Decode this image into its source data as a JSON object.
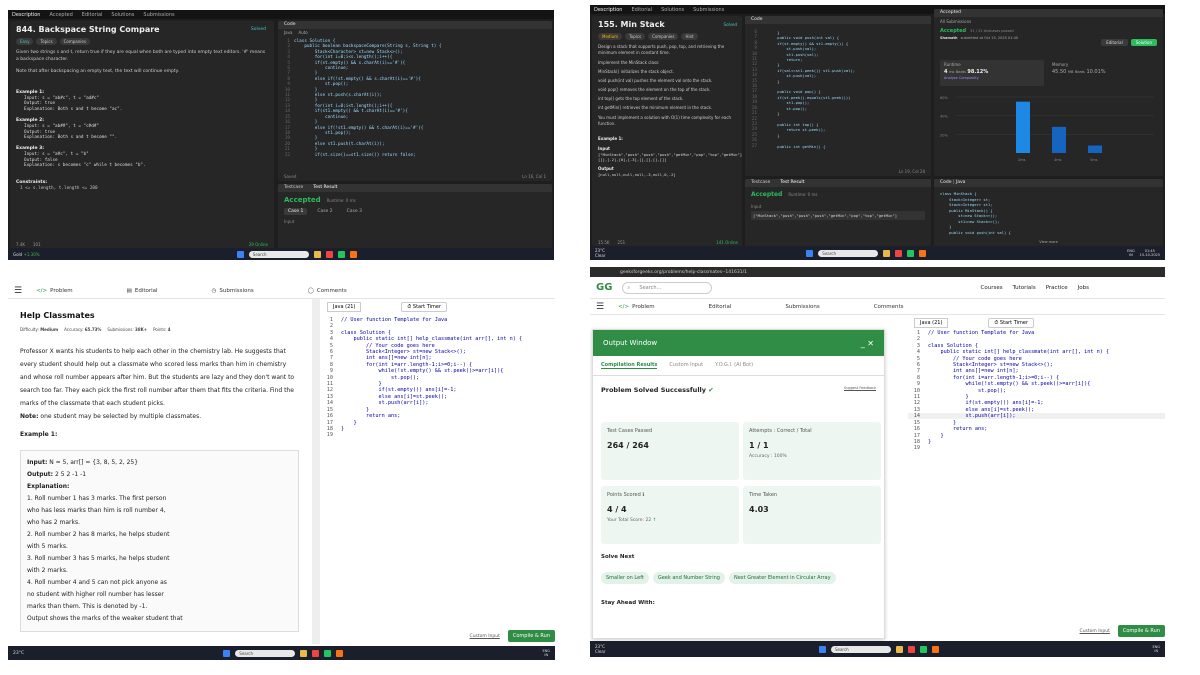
{
  "q1": {
    "nav": [
      "Description",
      "Accepted",
      "Editorial",
      "Solutions",
      "Submissions"
    ],
    "title": "844. Backspace String Compare",
    "status": "Solved",
    "tags": [
      "Easy",
      "Topics",
      "Companies"
    ],
    "desc1": "Given two strings s and t, return true if they are equal when both are typed into empty text editors. '#' means a backspace character.",
    "desc2": "Note that after backspacing an empty text, the text will continue empty.",
    "ex1_title": "Example 1:",
    "ex1": [
      "Input: s = \"ab#c\", t = \"ad#c\"",
      "Output: true",
      "Explanation: Both s and t become \"ac\"."
    ],
    "ex2_title": "Example 2:",
    "ex2": [
      "Input: s = \"ab##\", t = \"c#d#\"",
      "Output: true",
      "Explanation: Both s and t become \"\"."
    ],
    "ex3_title": "Example 3:",
    "ex3": [
      "Input: s = \"a#c\", t = \"b\"",
      "Output: false",
      "Explanation: s becomes \"c\" while t becomes \"b\"."
    ],
    "constraints": "Constraints:",
    "constraint1": "1 <= s.length, t.length <= 200",
    "likes": "7.4K",
    "comments": "101",
    "online": "29 Online",
    "code_header": "Code",
    "lang": "Java",
    "auto": "Auto",
    "code": "class Solution {\n    public boolean backspaceCompare(String s, String t) {\n        Stack<Character> st=new Stack<>();\n        for(int i=0;i<s.length();i++){\n        if(st.empty() && s.charAt(i)=='#'){\n            continue;\n        }\n        else if(!st.empty() && s.charAt(i)=='#'){\n            st.pop();\n        }\n        else st.push(s.charAt(i));\n        }\n        for(int i=0;i<t.length();i++){\n        if(st1.empty() && t.charAt(i)=='#'){\n            continue;\n        }\n        else if(!st1.empty() && t.charAt(i)=='#'){\n            st1.pop();\n        }\n        else st1.push(t.charAt(i));\n        }\n        if(st.size()==st1.size()) return false;",
    "saved": "Saved",
    "pos": "Ln 16, Col 1",
    "tabs": [
      "Testcase",
      "Test Result"
    ],
    "accepted": "Accepted",
    "runtime": "Runtime: 0 ms",
    "cases": [
      "Case 1",
      "Case 2",
      "Case 3"
    ],
    "input": "Input",
    "stock": "Gold",
    "stock_change": "+1.30%",
    "search": "Search"
  },
  "q2": {
    "nav": [
      "Description",
      "Editorial",
      "Solutions",
      "Submissions"
    ],
    "title": "155. Min Stack",
    "status": "Solved",
    "tags": [
      "Medium",
      "Topics",
      "Companies",
      "Hint"
    ],
    "desc": "Design a stack that supports push, pop, top, and retrieving the minimum element in constant time.",
    "impl": "Implement the MinStack class:",
    "bullets": [
      "MinStack() initializes the stack object.",
      "void push(int val) pushes the element val onto the stack.",
      "void pop() removes the element on the top of the stack.",
      "int top() gets the top element of the stack.",
      "int getMin() retrieves the minimum element in the stack."
    ],
    "note": "You must implement a solution with O(1) time complexity for each function.",
    "ex_title": "Example 1:",
    "input_lab": "Input",
    "input": "[\"MinStack\",\"push\",\"push\",\"push\",\"getMin\",\"pop\",\"top\",\"getMin\"]\n[[],[-2],[0],[-3],[],[],[],[]]",
    "output_lab": "Output",
    "output": "[null,null,null,null,-3,null,0,-2]",
    "code": "        }\n        public void push(int val) {\n        if(st.empty() && st1.empty()) {\n            st.push(val);\n            st1.push(val);\n            return;\n        }\n        if(val<=st1.peek()) st1.push(val);\n            st.push(val);\n        }\n\n        public void pop() {\n        if(st.peek().equals(st1.peek()))\n            st1.pop();\n            st.pop();\n        }\n\n        public int top() {\n            return st.peek();\n        }\n\n        public int getMin() {",
    "pos": "Ln 19, Col 28",
    "tabs": [
      "Testcase",
      "Test Result"
    ],
    "accepted": "Accepted",
    "runtime": "Runtime: 0 ms",
    "input2_lab": "Input",
    "input2": "[\"MinStack\",\"push\",\"push\",\"push\",\"getMin\",\"pop\",\"top\",\"getMin\"]",
    "likes": "15.5K",
    "comments": "251",
    "online": "141 Online",
    "acc_header": "Accepted",
    "all_sub": "All Submissions",
    "acc_status": "Accepted",
    "acc_sub": "31 / 31 testcases passed",
    "author": "Shamath",
    "submitted": "submitted at Oct 15, 2025 01:40",
    "editorial_btn": "Editorial",
    "solution_btn": "Solution",
    "runtime_lab": "Runtime",
    "runtime_val": "4",
    "runtime_unit": "ms",
    "beats_lab": "Beats",
    "beats_val": "98.12%",
    "analyze": "Analyze Complexity",
    "memory_lab": "Memory",
    "memory_val": "45.50",
    "memory_unit": "MB",
    "mem_beats": "Beats",
    "mem_beats_val": "10.01%",
    "y_ticks": [
      "60%",
      "40%",
      "20%"
    ],
    "x_ticks": [
      "2ms",
      "4ms",
      "5ms"
    ],
    "bars": [
      0.55,
      0.28,
      0.08
    ],
    "code2_lang": "Java",
    "code2": "class MinStack {\n    Stack<Integer> st;\n    Stack<Integer> st1;\n    public MinStack() {\n        st=new Stack<>();\n        st1=new Stack<>();\n    }\n    public void push(int val) {",
    "view_more": "View more",
    "weather": "23°C",
    "weather2": "Clear",
    "search": "Search",
    "lang_ind": "ENG",
    "region": "IN",
    "time": "01:45",
    "date": "15-10-2025"
  },
  "q3": {
    "tabs": [
      "Problem",
      "Editorial",
      "Submissions",
      "Comments"
    ],
    "title": "Help Classmates",
    "difficulty_lab": "Difficulty:",
    "difficulty": "Medium",
    "accuracy_lab": "Accuracy:",
    "accuracy": "65.73%",
    "subs_lab": "Submissions:",
    "subs": "38K+",
    "points_lab": "Points:",
    "points": "4",
    "desc": "Professor X wants his students to help each other in the chemistry lab. He suggests that every student should help out a classmate who scored less marks than him in chemistry and whose roll number appears after him. But the students are lazy and they don't want to search too far. They each pick the first roll number after them that fits the criteria. Find the marks of the classmate that each student picks.",
    "note_lab": "Note:",
    "note": "one student may be selected by multiple classmates.",
    "ex_title": "Example 1:",
    "ex_input_lab": "Input:",
    "ex_input": "N = 5, arr[] = {3, 8, 5, 2, 25}",
    "ex_output_lab": "Output:",
    "ex_output": "2 5 2 -1 -1",
    "ex_expl_lab": "Explanation:",
    "ex_expl": [
      "1. Roll number 1 has 3 marks. The first person",
      "who has less marks than him is roll number 4,",
      "who has 2 marks.",
      "2. Roll number 2 has 8 marks, he helps student",
      "with 5 marks.",
      "3. Roll number 3 has 5 marks, he helps student",
      "with 2 marks.",
      "4. Roll number 4 and 5 can not pick anyone as",
      "no student with higher roll number has lesser",
      "marks than them. This is denoted by -1."
    ],
    "ex_cut": "Output shows the marks of the weaker student that",
    "lang": "Java (21)",
    "timer": "Start Timer",
    "code": "// User function Template for Java\n\nclass Solution {\n    public static int[] help_classmate(int arr[], int n) {\n        // Your code goes here\n        Stack<Integer> st=new Stack<>();\n        int ans[]=new int[n];\n        for(int i=arr.length-1;i>=0;i--) {\n            while(!st.empty() && st.peek()>=arr[i]){\n                st.pop();\n            }\n            if(st.empty()) ans[i]=-1;\n            else ans[i]=st.peek();\n            st.push(arr[i]);\n        }\n        return ans;\n    }\n}\n",
    "custom_input": "Custom Input",
    "compile": "Compile & Run",
    "weather": "23°C",
    "search": "Search",
    "lang_ind": "ENG",
    "region": "IN"
  },
  "q4": {
    "url": "geeksforgeeks.org/problems/help-classmates--141631/1",
    "search_ph": "Search...",
    "menu": [
      "Courses",
      "Tutorials",
      "Practice",
      "Jobs"
    ],
    "tabs": [
      "Problem",
      "Editorial",
      "Submissions",
      "Comments"
    ],
    "out_title": "Output Window",
    "out_tabs": [
      "Compilation Results",
      "Custom Input",
      "Y.O.G.I. (AI Bot)"
    ],
    "solved": "Problem Solved Successfully",
    "feedback": "Suggest Feedback",
    "tc_lab": "Test Cases Passed",
    "tc_val": "264 / 264",
    "att_lab": "Attempts : Correct / Total",
    "att_val": "1 / 1",
    "acc_lab": "Accuracy :",
    "acc_val": "100%",
    "pts_lab": "Points Scored",
    "pts_val": "4 / 4",
    "total_lab": "Your Total Score:",
    "total_val": "22",
    "time_lab": "Time Taken",
    "time_val": "4.03",
    "solve_next": "Solve Next",
    "next": [
      "Smaller on Left",
      "Geek and Number String",
      "Next Greater Element in Circular Array"
    ],
    "stay": "Stay Ahead With:",
    "lang": "Java (21)",
    "timer": "Start Timer",
    "code": "// User function Template for Java\n\nclass Solution {\n    public static int[] help_classmate(int arr[], int n) {\n        // Your code goes here\n        Stack<Integer> st=new Stack<>();\n        int ans[]=new int[n];\n        for(int i=arr.length-1;i>=0;i--) {\n            while(!st.empty() && st.peek()>=arr[i]){\n                st.pop();\n            }\n            if(st.empty()) ans[i]=-1;\n            else ans[i]=st.peek();\n            st.push(arr[i]);\n        }\n        return ans;\n    }\n}\n",
    "custom_input": "Custom Input",
    "compile": "Compile & Run",
    "weather": "23°C",
    "weather2": "Clear",
    "search": "Search",
    "lang_ind": "ENG",
    "region": "IN"
  }
}
